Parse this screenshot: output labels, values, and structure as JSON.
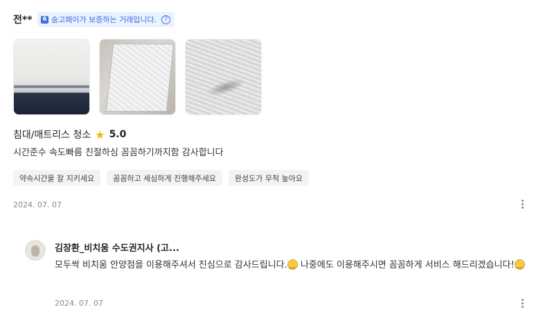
{
  "review": {
    "reviewer": "전**",
    "pay_badge": "숨고페이가 보증하는 거래입니다.",
    "pay_logo": "6",
    "help_icon": "?",
    "service": "침대/매트리스 청소",
    "rating": "5.0",
    "text": "시간준수 속도빠름 친절하심 꼼꼼하기까지함 감사합니다",
    "tags": [
      "약속시간을 잘 지키세요",
      "꼼꼼하고 세심하게 진행해주세요",
      "완성도가 무척 높아요"
    ],
    "date": "2024. 07. 07",
    "photos": [
      "mattress-photo-1",
      "mattress-photo-2",
      "mattress-photo-3"
    ]
  },
  "reply": {
    "pro_name": "김장환_비치움 수도권지사 (고...",
    "text_part1": "모두싹 비치움 안양점을 이용해주셔서 진심으로 감사드립니다.",
    "text_part2": " 나중에도 이용해주시면 꼼꼼하게 서비스 해드리겠습니다!",
    "date": "2024. 07. 07"
  },
  "colors": {
    "accent": "#3a6fe0",
    "star": "#f5b800"
  }
}
